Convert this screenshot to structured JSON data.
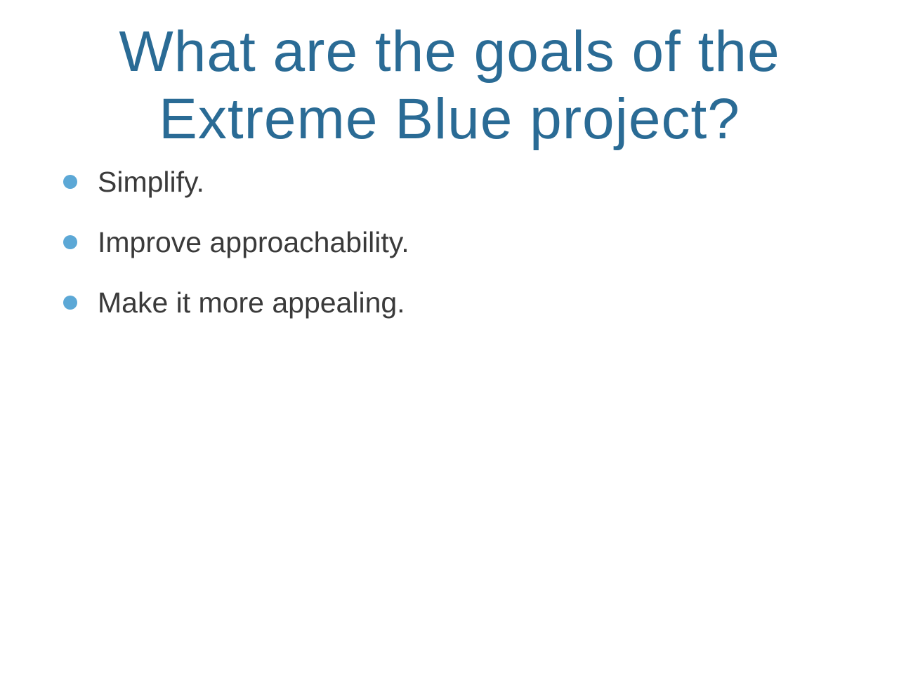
{
  "slide": {
    "title_lines": [
      "What are the goals of  the",
      "Extreme Blue project?"
    ],
    "bullets": [
      {
        "text": "Simplify."
      },
      {
        "text": "Improve approachability."
      },
      {
        "text": "Make it more appealing."
      }
    ]
  },
  "colors": {
    "title": "#2a6b95",
    "bullet_dot": "#5ca8d6",
    "body_text": "#3a3a3a",
    "background": "#ffffff"
  },
  "icons": {
    "bullet": "bullet-dot-icon"
  }
}
